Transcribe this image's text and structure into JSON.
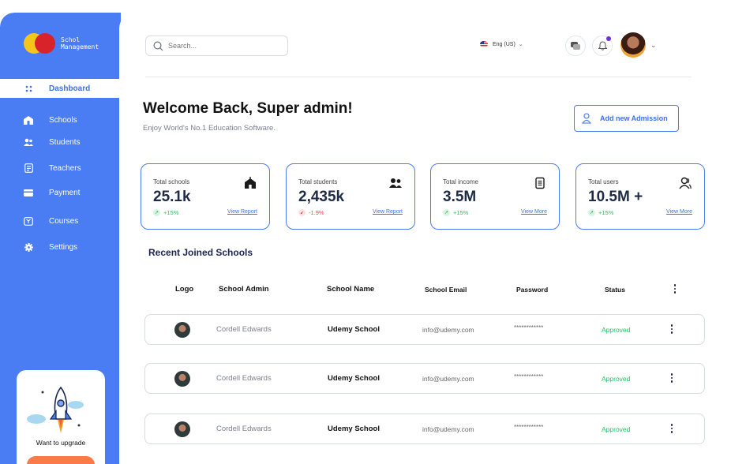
{
  "brand": {
    "line1": "Schol",
    "line2": "Management"
  },
  "sidebar": {
    "items": [
      {
        "label": "Dashboard",
        "icon": "grid-icon"
      },
      {
        "label": "Schools",
        "icon": "school-icon"
      },
      {
        "label": "Students",
        "icon": "users-icon"
      },
      {
        "label": "Teachers",
        "icon": "board-icon"
      },
      {
        "label": "Payment",
        "icon": "card-icon"
      },
      {
        "label": "Courses",
        "icon": "book-icon"
      },
      {
        "label": "Settings",
        "icon": "gear-icon"
      }
    ],
    "upgrade": {
      "text": "Want to upgrade"
    }
  },
  "header": {
    "search_placeholder": "Search...",
    "language": "Eng (US)"
  },
  "welcome": {
    "title": "Welcome Back, Super admin!",
    "subtitle": "Enjoy World's No.1 Education Software.",
    "add_button": "Add new Admission"
  },
  "stats": [
    {
      "title": "Total schools",
      "value": "25.1k",
      "change": "+15%",
      "trend": "up",
      "link": "View Report",
      "icon": "school-icon"
    },
    {
      "title": "Total students",
      "value": "2,435k",
      "change": "-1.9%",
      "trend": "down",
      "link": "View Report",
      "icon": "users-icon"
    },
    {
      "title": "Total income",
      "value": "3.5M",
      "change": "+15%",
      "trend": "up",
      "link": "View More",
      "icon": "document-icon"
    },
    {
      "title": "Total users",
      "value": "10.5M +",
      "change": "+15%",
      "trend": "up",
      "link": "View More",
      "icon": "user-group-icon"
    }
  ],
  "recent": {
    "title": "Recent Joined Schools",
    "columns": [
      "Logo",
      "School Admin",
      "School Name",
      "School Email",
      "Password",
      "Status"
    ],
    "rows": [
      {
        "admin": "Cordell Edwards",
        "school": "Udemy School",
        "email": "info@udemy.com",
        "password": "************",
        "status": "Approved"
      },
      {
        "admin": "Cordell Edwards",
        "school": "Udemy School",
        "email": "info@udemy.com",
        "password": "************",
        "status": "Approved"
      },
      {
        "admin": "Cordell Edwards",
        "school": "Udemy School",
        "email": "info@udemy.com",
        "password": "************",
        "status": "Approved"
      }
    ]
  },
  "colors": {
    "primary": "#4a7cf3",
    "success": "#22c55e",
    "danger": "#ef4444",
    "accent": "#fa7a4a"
  }
}
